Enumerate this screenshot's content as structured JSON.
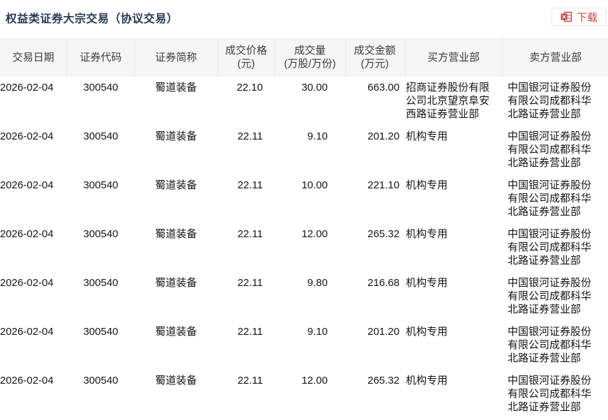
{
  "page": {
    "title": "权益类证券大宗交易（协议交易）"
  },
  "toolbar": {
    "download_label": "下载",
    "download_icon": "excel-file-icon",
    "accent_red": "#cb423f",
    "button_border": "#e7e7e7"
  },
  "colors": {
    "header_bg": "#f5f5f6",
    "header_text": "#3b3b3b",
    "body_text": "#141414",
    "title_text": "#273a56"
  },
  "table": {
    "columns": [
      {
        "key": "trade_date",
        "label": "交易日期"
      },
      {
        "key": "security_code",
        "label": "证券代码"
      },
      {
        "key": "security_name",
        "label": "证券简称"
      },
      {
        "key": "price",
        "label": "成交价格\n(元)"
      },
      {
        "key": "volume",
        "label": "成交量\n(万股/万份)"
      },
      {
        "key": "amount",
        "label": "成交金额\n(万元)"
      },
      {
        "key": "buyer_branch",
        "label": "买方营业部"
      },
      {
        "key": "seller_branch",
        "label": "卖方营业部"
      }
    ],
    "rows": [
      [
        "2026-02-04",
        "300540",
        "蜀道装备",
        "22.10",
        "30.00",
        "663.00",
        "招商证券股份有限公司北京望京阜安西路证券营业部",
        "中国银河证券股份有限公司成都科华北路证券营业部"
      ],
      [
        "2026-02-04",
        "300540",
        "蜀道装备",
        "22.11",
        "9.10",
        "201.20",
        "机构专用",
        "中国银河证券股份有限公司成都科华北路证券营业部"
      ],
      [
        "2026-02-04",
        "300540",
        "蜀道装备",
        "22.11",
        "10.00",
        "221.10",
        "机构专用",
        "中国银河证券股份有限公司成都科华北路证券营业部"
      ],
      [
        "2026-02-04",
        "300540",
        "蜀道装备",
        "22.11",
        "12.00",
        "265.32",
        "机构专用",
        "中国银河证券股份有限公司成都科华北路证券营业部"
      ],
      [
        "2026-02-04",
        "300540",
        "蜀道装备",
        "22.11",
        "9.80",
        "216.68",
        "机构专用",
        "中国银河证券股份有限公司成都科华北路证券营业部"
      ],
      [
        "2026-02-04",
        "300540",
        "蜀道装备",
        "22.11",
        "9.10",
        "201.20",
        "机构专用",
        "中国银河证券股份有限公司成都科华北路证券营业部"
      ],
      [
        "2026-02-04",
        "300540",
        "蜀道装备",
        "22.11",
        "12.00",
        "265.32",
        "机构专用",
        "中国银河证券股份有限公司成都科华北路证券营业部"
      ]
    ]
  }
}
